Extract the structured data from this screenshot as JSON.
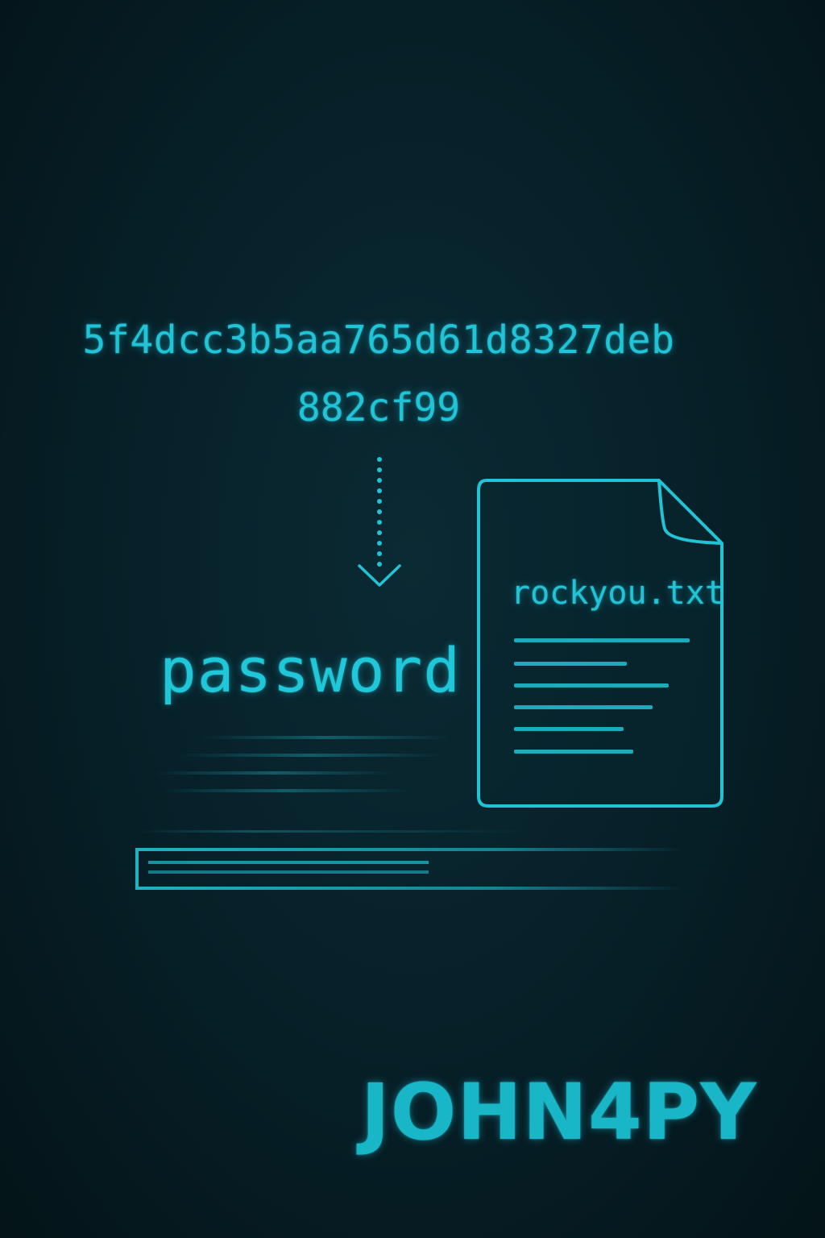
{
  "hash": {
    "line1": "5f4dcc3b5aa765d61d8327deb",
    "line2": "882cf99"
  },
  "cracked_password": "password",
  "wordlist": {
    "filename": "rockyou.txt"
  },
  "brand": "JOHN4PY",
  "icons": {
    "arrow": "dotted-arrow-down-icon",
    "file": "document-icon"
  },
  "colors": {
    "accent": "#21c3d6",
    "background": "#07212a"
  }
}
